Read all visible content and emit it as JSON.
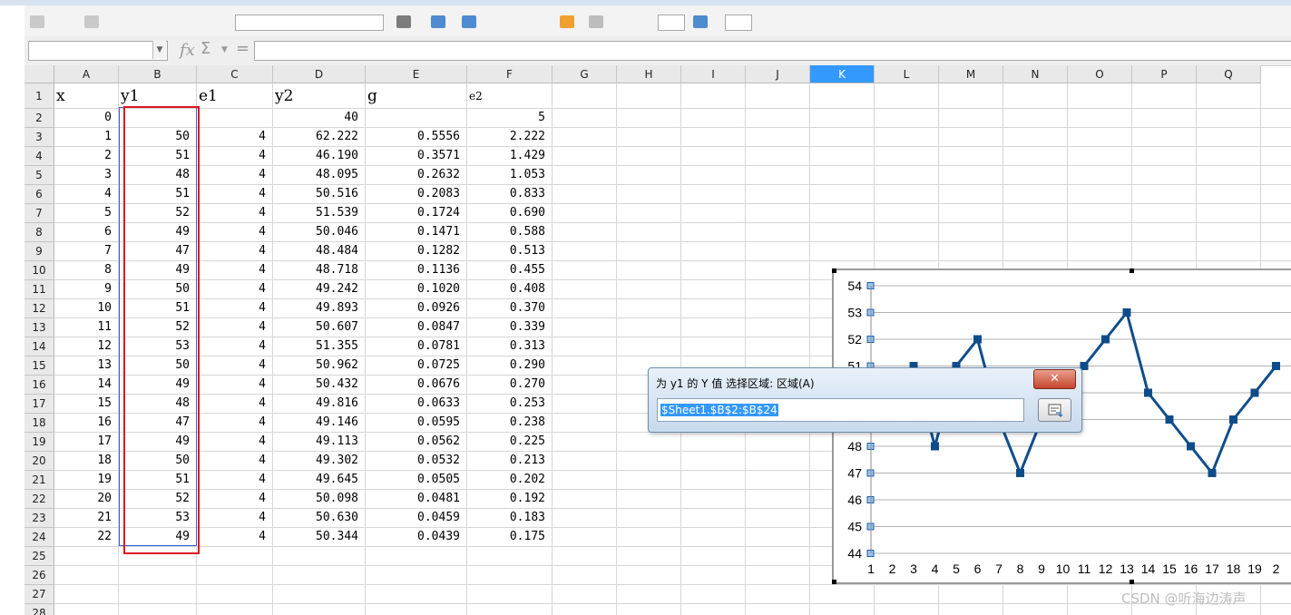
{
  "toolbar": {
    "icon_names": [
      "open-icon",
      "save-icon",
      "font-name-box",
      "bold-icon",
      "chart-icon",
      "table-icon",
      "sort-icon",
      "filter-icon",
      "image-icon",
      "draw-icon",
      "navigator-icon"
    ]
  },
  "formula_bar": {
    "name_box_value": "",
    "fx_glyph": "fx",
    "sum_glyph": "Σ",
    "equals_glyph": "=",
    "formula_value": ""
  },
  "sheet": {
    "selected_column": "K",
    "columns": [
      "A",
      "B",
      "C",
      "D",
      "E",
      "F",
      "G",
      "H",
      "I",
      "J",
      "K",
      "L",
      "M",
      "N",
      "O",
      "P",
      "Q"
    ],
    "row_numbers": [
      "1",
      "2",
      "3",
      "4",
      "5",
      "6",
      "7",
      "8",
      "9",
      "10",
      "11",
      "12",
      "13",
      "14",
      "15",
      "16",
      "17",
      "18",
      "19",
      "20",
      "21",
      "22",
      "23",
      "24",
      "25",
      "26",
      "27",
      "28"
    ],
    "header_row": {
      "A": "x",
      "B": "y1",
      "C": "e1",
      "D": "y2",
      "E": "g",
      "F": "e2"
    },
    "row2": {
      "A": "0",
      "D": "40",
      "F": "5"
    },
    "data_rows": [
      {
        "A": "1",
        "B": "50",
        "C": "4",
        "D": "62.222",
        "E": "0.5556",
        "F": "2.222"
      },
      {
        "A": "2",
        "B": "51",
        "C": "4",
        "D": "46.190",
        "E": "0.3571",
        "F": "1.429"
      },
      {
        "A": "3",
        "B": "48",
        "C": "4",
        "D": "48.095",
        "E": "0.2632",
        "F": "1.053"
      },
      {
        "A": "4",
        "B": "51",
        "C": "4",
        "D": "50.516",
        "E": "0.2083",
        "F": "0.833"
      },
      {
        "A": "5",
        "B": "52",
        "C": "4",
        "D": "51.539",
        "E": "0.1724",
        "F": "0.690"
      },
      {
        "A": "6",
        "B": "49",
        "C": "4",
        "D": "50.046",
        "E": "0.1471",
        "F": "0.588"
      },
      {
        "A": "7",
        "B": "47",
        "C": "4",
        "D": "48.484",
        "E": "0.1282",
        "F": "0.513"
      },
      {
        "A": "8",
        "B": "49",
        "C": "4",
        "D": "48.718",
        "E": "0.1136",
        "F": "0.455"
      },
      {
        "A": "9",
        "B": "50",
        "C": "4",
        "D": "49.242",
        "E": "0.1020",
        "F": "0.408"
      },
      {
        "A": "10",
        "B": "51",
        "C": "4",
        "D": "49.893",
        "E": "0.0926",
        "F": "0.370"
      },
      {
        "A": "11",
        "B": "52",
        "C": "4",
        "D": "50.607",
        "E": "0.0847",
        "F": "0.339"
      },
      {
        "A": "12",
        "B": "53",
        "C": "4",
        "D": "51.355",
        "E": "0.0781",
        "F": "0.313"
      },
      {
        "A": "13",
        "B": "50",
        "C": "4",
        "D": "50.962",
        "E": "0.0725",
        "F": "0.290"
      },
      {
        "A": "14",
        "B": "49",
        "C": "4",
        "D": "50.432",
        "E": "0.0676",
        "F": "0.270"
      },
      {
        "A": "15",
        "B": "48",
        "C": "4",
        "D": "49.816",
        "E": "0.0633",
        "F": "0.253"
      },
      {
        "A": "16",
        "B": "47",
        "C": "4",
        "D": "49.146",
        "E": "0.0595",
        "F": "0.238"
      },
      {
        "A": "17",
        "B": "49",
        "C": "4",
        "D": "49.113",
        "E": "0.0562",
        "F": "0.225"
      },
      {
        "A": "18",
        "B": "50",
        "C": "4",
        "D": "49.302",
        "E": "0.0532",
        "F": "0.213"
      },
      {
        "A": "19",
        "B": "51",
        "C": "4",
        "D": "49.645",
        "E": "0.0505",
        "F": "0.202"
      },
      {
        "A": "20",
        "B": "52",
        "C": "4",
        "D": "50.098",
        "E": "0.0481",
        "F": "0.192"
      },
      {
        "A": "21",
        "B": "53",
        "C": "4",
        "D": "50.630",
        "E": "0.0459",
        "F": "0.183"
      },
      {
        "A": "22",
        "B": "49",
        "C": "4",
        "D": "50.344",
        "E": "0.0439",
        "F": "0.175"
      }
    ]
  },
  "dialog": {
    "title": "为 y1 的 Y 值 选择区域: 区域(A)",
    "close_label": "✕",
    "range_value": "$Sheet1.$B$2:$B$24"
  },
  "watermark": "CSDN @听海边涛声",
  "colors": {
    "series_line": "#0f4d8a",
    "selection_red": "#e0141e",
    "selected_header": "#3399ff"
  },
  "chart_data": {
    "type": "line",
    "x": [
      "1",
      "2",
      "3",
      "4",
      "5",
      "6",
      "7",
      "8",
      "9",
      "10",
      "11",
      "12",
      "13",
      "14",
      "15",
      "16",
      "17",
      "18",
      "19",
      "2"
    ],
    "series": [
      {
        "values": [
          null,
          null,
          51,
          48,
          51,
          52,
          49,
          47,
          49,
          50,
          51,
          52,
          53,
          50,
          49,
          48,
          47,
          49,
          50,
          51
        ]
      }
    ],
    "y_ticks": [
      "44",
      "45",
      "46",
      "47",
      "48",
      "49",
      "50",
      "51",
      "52",
      "53",
      "54"
    ],
    "ylim": [
      44,
      54
    ],
    "grid": true
  }
}
